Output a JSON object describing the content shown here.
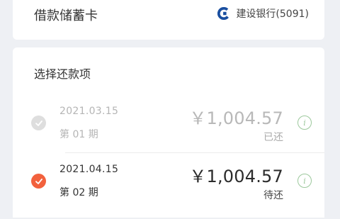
{
  "debit_card": {
    "label": "借款储蓄卡",
    "bank_name": "建设银行(5091)",
    "bank_icon": "ccb-bank-logo"
  },
  "repayment": {
    "section_title": "选择还款项",
    "items": [
      {
        "date": "2021.03.15",
        "period": "第 01 期",
        "amount": "￥1,004.57",
        "status": "已还",
        "state": "paid",
        "checked": true
      },
      {
        "date": "2021.04.15",
        "period": "第 02 期",
        "amount": "￥1,004.57",
        "status": "待还",
        "state": "pending",
        "checked": true
      }
    ]
  },
  "colors": {
    "accent": "#f2613d",
    "paid_check": "#dedede",
    "info_icon": "#9cc89c",
    "bank_logo": "#1a4fa0"
  }
}
